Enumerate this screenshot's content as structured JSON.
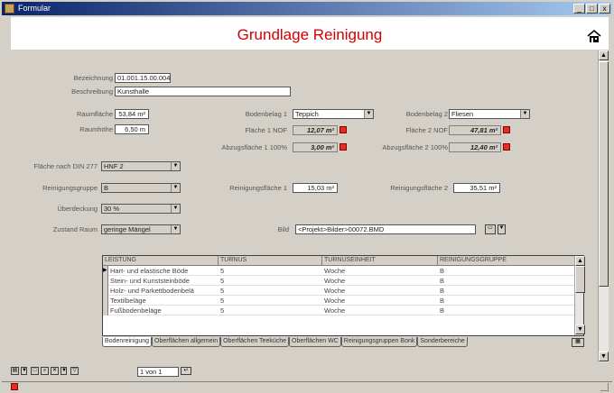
{
  "window": {
    "title": "Formular",
    "btn_min": "_",
    "btn_max": "□",
    "btn_close": "x"
  },
  "header": {
    "title": "Grundlage Reinigung"
  },
  "form": {
    "bezeichnung_label": "Bezeichnung",
    "bezeichnung_value": "01.001.15.00.004",
    "beschreibung_label": "Beschreibung",
    "beschreibung_value": "Kunsthalle",
    "raumflaeche_label": "Raumfläche",
    "raumflaeche_value": "53,84 m²",
    "raumhoehe_label": "Raumhöhe",
    "raumhoehe_value": "6,50 m",
    "bodenbelag1_label": "Bodenbelag 1",
    "bodenbelag1_value": "Teppich",
    "flaeche1_label": "Fläche 1 NOF",
    "flaeche1_value": "12,07 m²",
    "abzug1_label": "Abzugsfläche 1 100%",
    "abzug1_value": "3,00 m²",
    "bodenbelag2_label": "Bodenbelag 2",
    "bodenbelag2_value": "Fliesen",
    "flaeche2_label": "Fläche 2 NOF",
    "flaeche2_value": "47,81 m²",
    "abzug2_label": "Abzugsfläche 2 100%",
    "abzug2_value": "12,40 m²",
    "din277_label": "Fläche nach DIN 277",
    "din277_value": "HNF 2",
    "gruppe_label": "Reinigungsgruppe",
    "gruppe_value": "B",
    "rflaeche1_label": "Reinigungsfläche 1",
    "rflaeche1_value": "15,03 m²",
    "rflaeche2_label": "Reinigungsfläche 2",
    "rflaeche2_value": "35,51 m²",
    "oberdeckung_label": "Überdeckung",
    "oberdeckung_value": "30 %",
    "zustand_label": "Zustand Raum",
    "zustand_value": "geringe Mängel",
    "bild_label": "Bild",
    "bild_value": "<Projekt>Bilder>00072.BMD"
  },
  "grid": {
    "headers": [
      "LEISTUNG",
      "TURNUS",
      "TURNUSEINHEIT",
      "REINIGUNGSGRUPPE"
    ],
    "rows": [
      [
        "Hart- und elastische Böde",
        "5",
        "Woche",
        "B"
      ],
      [
        "Stein- und Kunststeinböde",
        "5",
        "Woche",
        "B"
      ],
      [
        "Holz- und Parkettbodenbelä",
        "5",
        "Woche",
        "B"
      ],
      [
        "Textilbeläge",
        "5",
        "Woche",
        "B"
      ],
      [
        "Fußbodenbeläge",
        "5",
        "Woche",
        "B"
      ]
    ]
  },
  "tabs": [
    "Bodenreinigung",
    "Oberflächen allgemein",
    "Oberflächen Teeküche",
    "Oberflächen WC",
    "Reinigungsgruppen Bonk",
    "Sonderbereiche"
  ],
  "toolbar": {
    "record_nav": "1 von 1"
  }
}
